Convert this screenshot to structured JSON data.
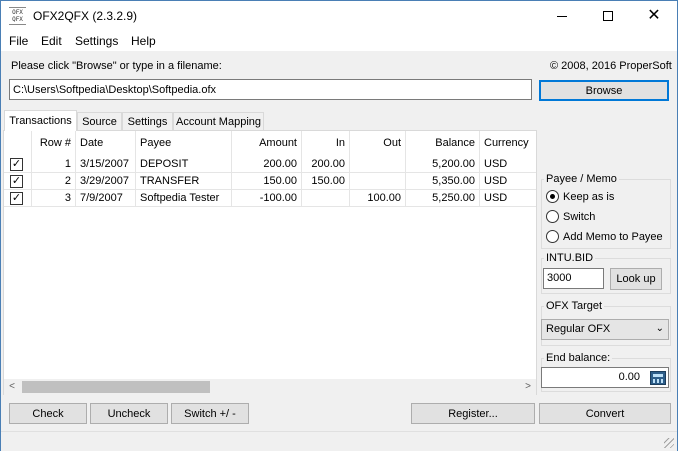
{
  "window": {
    "title": "OFX2QFX (2.3.2.9)",
    "icon_text": [
      "OFX",
      "QFX"
    ],
    "close_glyph": "✕"
  },
  "menu": [
    "File",
    "Edit",
    "Settings",
    "Help"
  ],
  "prompt_label": "Please click \"Browse\" or type in a filename:",
  "copyright": "© 2008, 2016 ProperSoft",
  "file_path": "C:\\Users\\Softpedia\\Desktop\\Softpedia.ofx",
  "browse_label": "Browse",
  "tabs": [
    "Transactions",
    "Source",
    "Settings",
    "Account Mapping"
  ],
  "grid": {
    "columns": [
      "Row #",
      "Date",
      "Payee",
      "Amount",
      "In",
      "Out",
      "Balance",
      "Currency"
    ],
    "rows": [
      {
        "checked": true,
        "row": "1",
        "date": "3/15/2007",
        "payee": "DEPOSIT",
        "amount": "200.00",
        "in": "200.00",
        "out": "",
        "balance": "5,200.00",
        "currency": "USD"
      },
      {
        "checked": true,
        "row": "2",
        "date": "3/29/2007",
        "payee": "TRANSFER",
        "amount": "150.00",
        "in": "150.00",
        "out": "",
        "balance": "5,350.00",
        "currency": "USD"
      },
      {
        "checked": true,
        "row": "3",
        "date": "7/9/2007",
        "payee": "Softpedia Tester",
        "amount": "-100.00",
        "in": "",
        "out": "100.00",
        "balance": "5,250.00",
        "currency": "USD"
      }
    ],
    "check_glyph": "✓",
    "scroll_left": "<",
    "scroll_right": ">"
  },
  "payee_memo": {
    "label": "Payee / Memo",
    "options": [
      "Keep as is",
      "Switch",
      "Add Memo to Payee"
    ],
    "selected": 0
  },
  "intu_bid": {
    "label": "INTU.BID",
    "value": "3000",
    "lookup_label": "Look up"
  },
  "ofx_target": {
    "label": "OFX Target",
    "value": "Regular OFX",
    "chevron": "⌄"
  },
  "end_balance": {
    "label": "End balance:",
    "value": "0.00"
  },
  "buttons": {
    "check": "Check",
    "uncheck": "Uncheck",
    "switch": "Switch +/ -",
    "register": "Register...",
    "convert": "Convert"
  }
}
